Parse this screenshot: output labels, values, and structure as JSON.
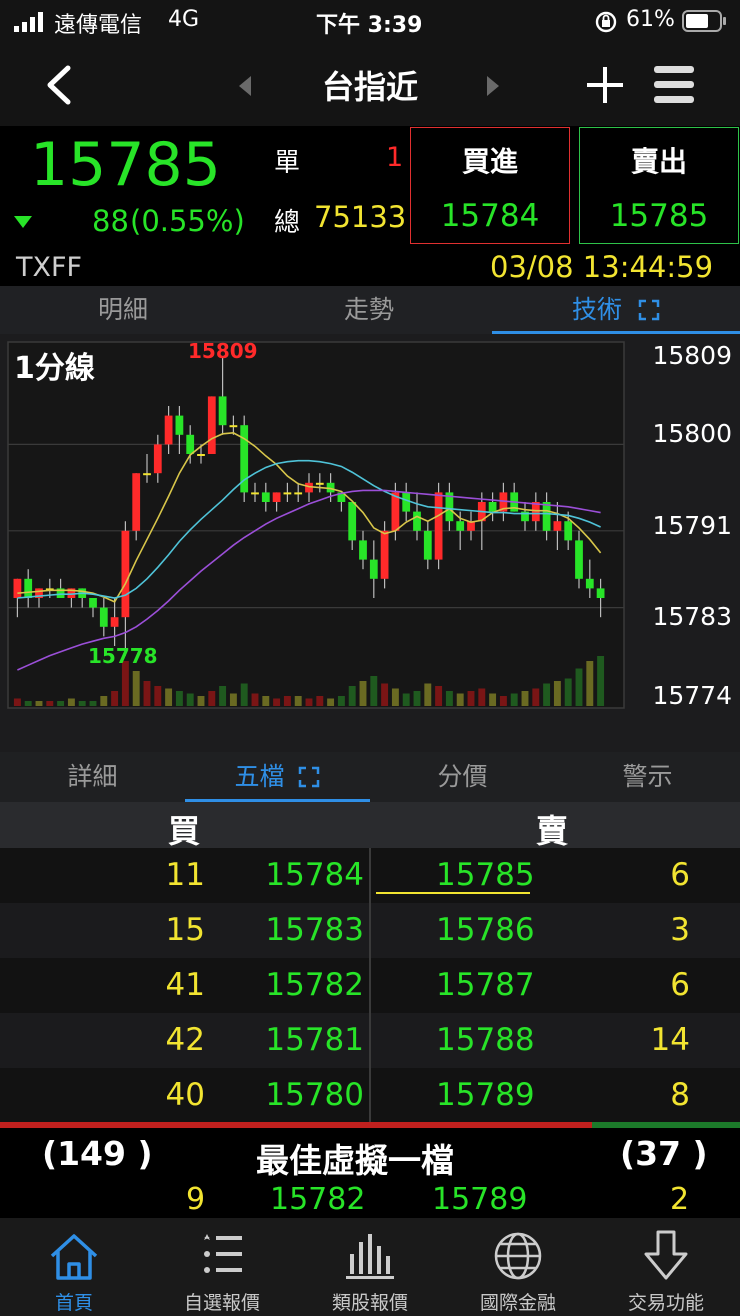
{
  "status_bar": {
    "carrier": "遠傳電信",
    "network": "4G",
    "time": "下午 3:39",
    "battery": "61%"
  },
  "nav": {
    "title": "台指近",
    "back_icon": "chevron-left-icon",
    "add_icon": "plus-icon",
    "menu_icon": "hamburger-menu-icon"
  },
  "quote": {
    "last_price": "15785",
    "change": "88",
    "change_pct": "(0.55%)",
    "single_label": "單",
    "single_value": "1",
    "total_label": "總",
    "total_value": "75133",
    "buy_label": "買進",
    "buy_price": "15784",
    "sell_label": "賣出",
    "sell_price": "15785",
    "symbol": "TXFF",
    "datetime": "03/08 13:44:59"
  },
  "top_tabs": [
    {
      "label": "明細"
    },
    {
      "label": "走勢"
    },
    {
      "label": "技術"
    }
  ],
  "chart": {
    "period_label": "1分線",
    "high_label": "15809",
    "low_label": "15778",
    "y_ticks": [
      "15809",
      "15800",
      "15791",
      "15783",
      "15774"
    ]
  },
  "chart_data": {
    "type": "candlestick",
    "title": "1分線",
    "ylim": [
      15774,
      15809
    ],
    "candles": [
      [
        15784,
        15786,
        15782,
        15786
      ],
      [
        15786,
        15787,
        15783,
        15784
      ],
      [
        15784,
        15785,
        15783,
        15785
      ],
      [
        15785,
        15786,
        15784,
        15785
      ],
      [
        15785,
        15786,
        15784,
        15784
      ],
      [
        15784,
        15785,
        15783,
        15785
      ],
      [
        15785,
        15785,
        15783,
        15784
      ],
      [
        15784,
        15784,
        15782,
        15783
      ],
      [
        15783,
        15784,
        15780,
        15781
      ],
      [
        15781,
        15784,
        15779,
        15782
      ],
      [
        15782,
        15792,
        15778,
        15791
      ],
      [
        15791,
        15797,
        15790,
        15797
      ],
      [
        15797,
        15799,
        15796,
        15797
      ],
      [
        15797,
        15801,
        15796,
        15800
      ],
      [
        15800,
        15804,
        15799,
        15803
      ],
      [
        15803,
        15804,
        15799,
        15801
      ],
      [
        15801,
        15802,
        15798,
        15799
      ],
      [
        15799,
        15800,
        15798,
        15799
      ],
      [
        15799,
        15805,
        15799,
        15805
      ],
      [
        15805,
        15809,
        15801,
        15802
      ],
      [
        15802,
        15803,
        15801,
        15802
      ],
      [
        15802,
        15803,
        15794,
        15795
      ],
      [
        15795,
        15796,
        15794,
        15795
      ],
      [
        15795,
        15796,
        15793,
        15794
      ],
      [
        15794,
        15795,
        15793,
        15795
      ],
      [
        15795,
        15796,
        15794,
        15795
      ],
      [
        15795,
        15796,
        15794,
        15795
      ],
      [
        15795,
        15797,
        15794,
        15796
      ],
      [
        15796,
        15797,
        15795,
        15796
      ],
      [
        15796,
        15797,
        15794,
        15795
      ],
      [
        15795,
        15795,
        15793,
        15794
      ],
      [
        15794,
        15794,
        15789,
        15790
      ],
      [
        15790,
        15791,
        15787,
        15788
      ],
      [
        15788,
        15790,
        15784,
        15786
      ],
      [
        15786,
        15792,
        15785,
        15791
      ],
      [
        15791,
        15796,
        15790,
        15795
      ],
      [
        15795,
        15796,
        15792,
        15793
      ],
      [
        15793,
        15795,
        15790,
        15791
      ],
      [
        15791,
        15792,
        15787,
        15788
      ],
      [
        15788,
        15796,
        15787,
        15795
      ],
      [
        15795,
        15796,
        15791,
        15792
      ],
      [
        15792,
        15793,
        15789,
        15791
      ],
      [
        15791,
        15793,
        15790,
        15792
      ],
      [
        15792,
        15795,
        15789,
        15794
      ],
      [
        15794,
        15795,
        15792,
        15793
      ],
      [
        15793,
        15796,
        15792,
        15795
      ],
      [
        15795,
        15796,
        15793,
        15793
      ],
      [
        15793,
        15794,
        15791,
        15792
      ],
      [
        15792,
        15795,
        15791,
        15794
      ],
      [
        15794,
        15795,
        15790,
        15791
      ],
      [
        15791,
        15794,
        15789,
        15792
      ],
      [
        15792,
        15793,
        15789,
        15790
      ],
      [
        15790,
        15791,
        15785,
        15786
      ],
      [
        15786,
        15788,
        15784,
        15785
      ],
      [
        15785,
        15786,
        15782,
        15784
      ]
    ],
    "ma_short": [
      15784.5,
      15784.6,
      15784.7,
      15784.8,
      15784.8,
      15784.8,
      15784.7,
      15784.5,
      15784.1,
      15783.6,
      15785.5,
      15787.9,
      15790.1,
      15792.3,
      15794.6,
      15797.0,
      15798.9,
      15799.8,
      15800.6,
      15801.1,
      15801.2,
      15800.6,
      15799.8,
      15798.8,
      15797.9,
      15796.7,
      15795.9,
      15795.6,
      15795.5,
      15795.4,
      15795.1,
      15794.1,
      15792.9,
      15791.3,
      15790.7,
      15791.0,
      15791.9,
      15792.5,
      15792.0,
      15792.6,
      15793.3,
      15792.3,
      15791.9,
      15792.1,
      15792.9,
      15793.3,
      15793.4,
      15793.2,
      15793.1,
      15793.1,
      15792.8,
      15792.3,
      15791.3,
      15790.1,
      15788.7
    ],
    "ma_mid": [
      15784.0,
      15784.1,
      15784.2,
      15784.3,
      15784.4,
      15784.4,
      15784.5,
      15784.4,
      15784.2,
      15784.0,
      15784.3,
      15785.0,
      15786.0,
      15787.2,
      15788.5,
      15789.9,
      15791.1,
      15792.2,
      15793.2,
      15794.2,
      15795.3,
      15796.3,
      15797.0,
      15797.6,
      15798.0,
      15798.2,
      15798.3,
      15798.3,
      15798.2,
      15798.0,
      15797.7,
      15797.1,
      15796.4,
      15795.7,
      15795.1,
      15794.6,
      15794.2,
      15793.8,
      15793.5,
      15793.4,
      15793.3,
      15793.2,
      15793.1,
      15793.0,
      15792.9,
      15792.9,
      15792.8,
      15792.8,
      15792.8,
      15792.8,
      15792.7,
      15792.6,
      15792.3,
      15791.9,
      15791.4
    ],
    "ma_long": [
      15776.5,
      15777.0,
      15777.5,
      15778.0,
      15778.4,
      15778.8,
      15779.2,
      15779.5,
      15779.8,
      15780.0,
      15780.4,
      15781.0,
      15781.8,
      15782.7,
      15783.7,
      15784.8,
      15785.8,
      15786.8,
      15787.7,
      15788.6,
      15789.5,
      15790.3,
      15791.0,
      15791.7,
      15792.3,
      15792.8,
      15793.3,
      15793.8,
      15794.2,
      15794.6,
      15794.9,
      15795.1,
      15795.2,
      15795.2,
      15795.2,
      15795.1,
      15795.0,
      15794.9,
      15794.8,
      15794.7,
      15794.6,
      15794.5,
      15794.4,
      15794.3,
      15794.2,
      15794.1,
      15794.0,
      15793.9,
      15793.8,
      15793.7,
      15793.6,
      15793.5,
      15793.3,
      15793.1,
      15792.9
    ],
    "volume": [
      3,
      2,
      2,
      2,
      2,
      3,
      2,
      2,
      4,
      6,
      18,
      14,
      10,
      8,
      7,
      6,
      5,
      4,
      6,
      8,
      5,
      9,
      5,
      4,
      3,
      4,
      4,
      3,
      4,
      3,
      4,
      8,
      10,
      12,
      9,
      7,
      5,
      6,
      9,
      8,
      6,
      5,
      6,
      7,
      5,
      4,
      5,
      6,
      7,
      9,
      10,
      11,
      15,
      18,
      20
    ]
  },
  "book_tabs": [
    {
      "label": "詳細"
    },
    {
      "label": "五檔"
    },
    {
      "label": "分價"
    },
    {
      "label": "警示"
    }
  ],
  "book": {
    "buy_header": "買",
    "sell_header": "賣",
    "rows": [
      {
        "bid_qty": "11",
        "bid_price": "15784",
        "ask_price": "15785",
        "ask_qty": "6"
      },
      {
        "bid_qty": "15",
        "bid_price": "15783",
        "ask_price": "15786",
        "ask_qty": "3"
      },
      {
        "bid_qty": "41",
        "bid_price": "15782",
        "ask_price": "15787",
        "ask_qty": "6"
      },
      {
        "bid_qty": "42",
        "bid_price": "15781",
        "ask_price": "15788",
        "ask_qty": "14"
      },
      {
        "bid_qty": "40",
        "bid_price": "15780",
        "ask_price": "15789",
        "ask_qty": "8"
      }
    ],
    "buy_total": "(149 )",
    "best_virtual_label": "最佳虛擬一檔",
    "sell_total": "(37 )",
    "virtual": {
      "bid_qty": "9",
      "bid_price": "15782",
      "ask_price": "15789",
      "ask_qty": "2"
    },
    "buy_ratio": 0.8
  },
  "bottom_nav": [
    {
      "label": "首頁",
      "icon": "home-icon"
    },
    {
      "label": "自選報價",
      "icon": "watchlist-icon"
    },
    {
      "label": "類股報價",
      "icon": "bar-chart-icon"
    },
    {
      "label": "國際金融",
      "icon": "globe-icon"
    },
    {
      "label": "交易功能",
      "icon": "trade-arrow-icon"
    }
  ],
  "colors": {
    "up": "#ff2a2a",
    "down": "#28e428",
    "accent": "#2f8fe6",
    "highlight": "#f2e431"
  }
}
